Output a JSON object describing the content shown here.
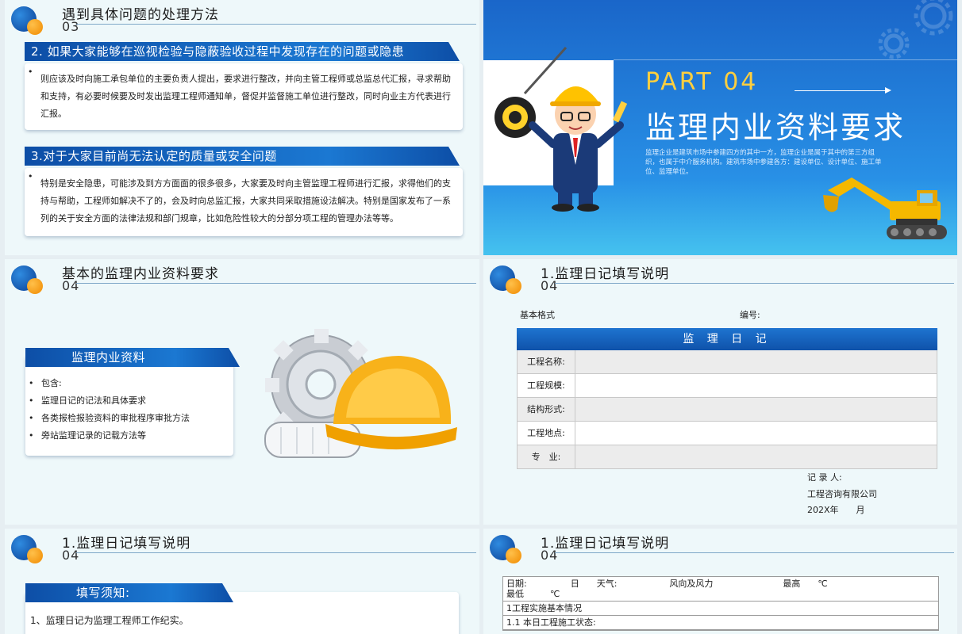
{
  "slide1": {
    "title": "遇到具体问题的处理方法",
    "num": "03",
    "sections": [
      {
        "heading": "2. 如果大家能够在巡视检验与隐蔽验收过程中发现存在的问题或隐患",
        "bullets": [
          "则应该及时向施工承包单位的主要负责人提出，要求进行整改，并向主管工程师或总监总代汇报，寻求帮助和支持，有必要时候要及时发出监理工程师通知单，督促并监督施工单位进行整改，同时向业主方代表进行汇报。"
        ]
      },
      {
        "heading": "3.对于大家目前尚无法认定的质量或安全问题",
        "bullets": [
          "特别是安全隐患，可能涉及到方方面面的很多很多，大家要及时向主管监理工程师进行汇报，求得他们的支持与帮助，工程师如解决不了的，会及时向总监汇报，大家共同采取措施设法解决。特别是国家发布了一系列的关于安全方面的法律法规和部门规章，比如危险性较大的分部分项工程的管理办法等等。"
        ]
      }
    ]
  },
  "slide2": {
    "part": "PART 04",
    "title": "监理内业资料要求",
    "desc": "监理企业是建筑市场中参建四方的其中一方，监理企业是属于其中的第三方组织，也属于中介服务机构。建筑市场中参建各方：建设单位、设计单位、施工单位、监理单位。"
  },
  "slide3": {
    "title": "基本的监理内业资料要求",
    "num": "04",
    "banner": "监理内业资料",
    "bullets": [
      "包含:",
      "监理日记的记法和具体要求",
      "各类报检报验资料的审批程序审批方法",
      "旁站监理记录的记载方法等"
    ]
  },
  "slide4": {
    "title": "1.监理日记填写说明",
    "num": "04",
    "basic_format": "基本格式",
    "number_label": "编号:",
    "table_title": "监 理 日 记",
    "rows": [
      "工程名称:",
      "工程规模:",
      "结构形式:",
      "工程地点:",
      "专　业:"
    ],
    "recorder": "记 录 人:",
    "company": "工程咨询有限公司",
    "date": "202X年　　月"
  },
  "slide5": {
    "title": "1.监理日记填写说明",
    "num": "04",
    "banner": "填写须知:",
    "item1": "1、监理日记为监理工程师工作纪实。"
  },
  "slide6": {
    "title": "1.监理日记填写说明",
    "num": "04",
    "row1": "日期:　　　　　日　　天气:　　　　　　风向及风力　　　　　　　　最高　　℃",
    "row1b": "最低　　　℃",
    "row2": "1工程实施基本情况",
    "row3": "1.1 本日工程施工状态:"
  },
  "colors": {
    "accent_blue": "#1565c0",
    "accent_orange": "#f59a12",
    "slide_bg": "#eef8fa"
  }
}
